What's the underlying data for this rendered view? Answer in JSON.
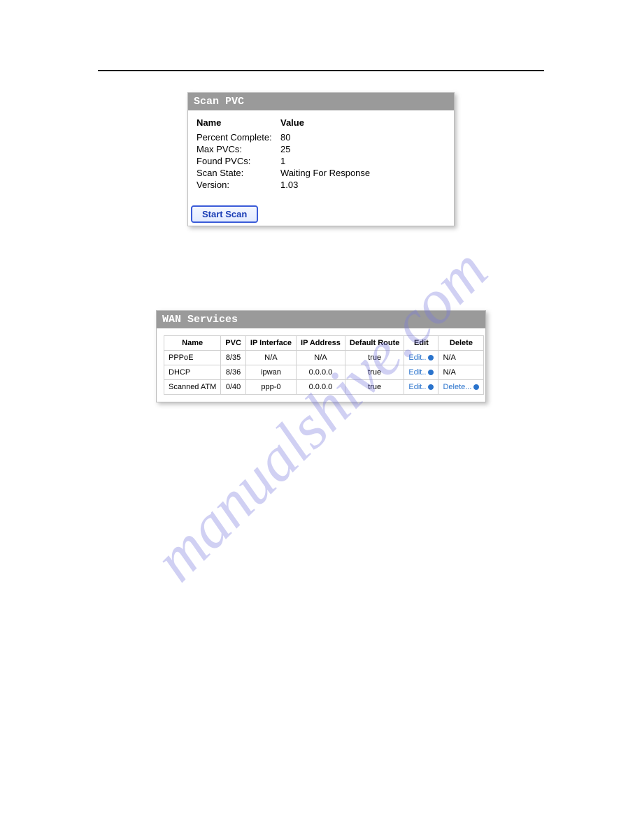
{
  "watermark": "manualshive.com",
  "scan_pvc": {
    "title": "Scan PVC",
    "headers": {
      "name": "Name",
      "value": "Value"
    },
    "rows": [
      {
        "name": "Percent Complete:",
        "value": "80"
      },
      {
        "name": "Max PVCs:",
        "value": "25"
      },
      {
        "name": "Found PVCs:",
        "value": "1"
      },
      {
        "name": "Scan State:",
        "value": "Waiting For Response"
      },
      {
        "name": "Version:",
        "value": "1.03"
      }
    ],
    "button": "Start Scan"
  },
  "wan": {
    "title": "WAN Services",
    "headers": [
      "Name",
      "PVC",
      "IP Interface",
      "IP Address",
      "Default Route",
      "Edit",
      "Delete"
    ],
    "rows": [
      {
        "name": "PPPoE",
        "pvc": "8/35",
        "iface": "N/A",
        "ip": "N/A",
        "route": "true",
        "edit": "Edit..",
        "del": "N/A",
        "del_link": false
      },
      {
        "name": "DHCP",
        "pvc": "8/36",
        "iface": "ipwan",
        "ip": "0.0.0.0",
        "route": "true",
        "edit": "Edit..",
        "del": "N/A",
        "del_link": false
      },
      {
        "name": "Scanned ATM",
        "pvc": "0/40",
        "iface": "ppp-0",
        "ip": "0.0.0.0",
        "route": "true",
        "edit": "Edit..",
        "del": "Delete...",
        "del_link": true
      }
    ]
  }
}
